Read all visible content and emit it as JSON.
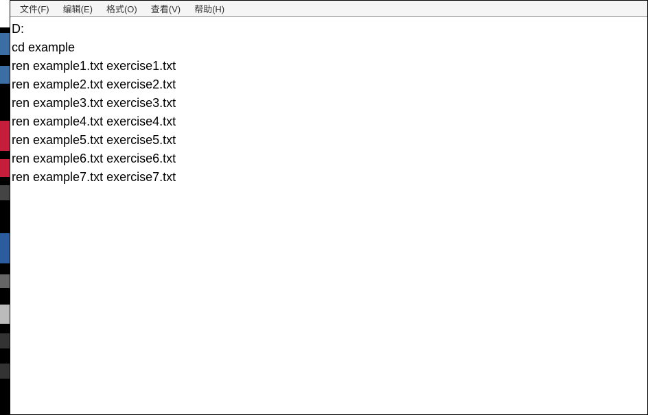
{
  "menu": {
    "file": "文件(F)",
    "edit": "编辑(E)",
    "format": "格式(O)",
    "view": "查看(V)",
    "help": "帮助(H)"
  },
  "content": {
    "l0": "D:",
    "l1": "cd example",
    "l2": "ren example1.txt exercise1.txt",
    "l3": "ren example2.txt exercise2.txt",
    "l4": "ren example3.txt exercise3.txt",
    "l5": "ren example4.txt exercise4.txt",
    "l6": "ren example5.txt exercise5.txt",
    "l7": "ren example6.txt exercise6.txt",
    "l8": "ren example7.txt exercise7.txt"
  }
}
